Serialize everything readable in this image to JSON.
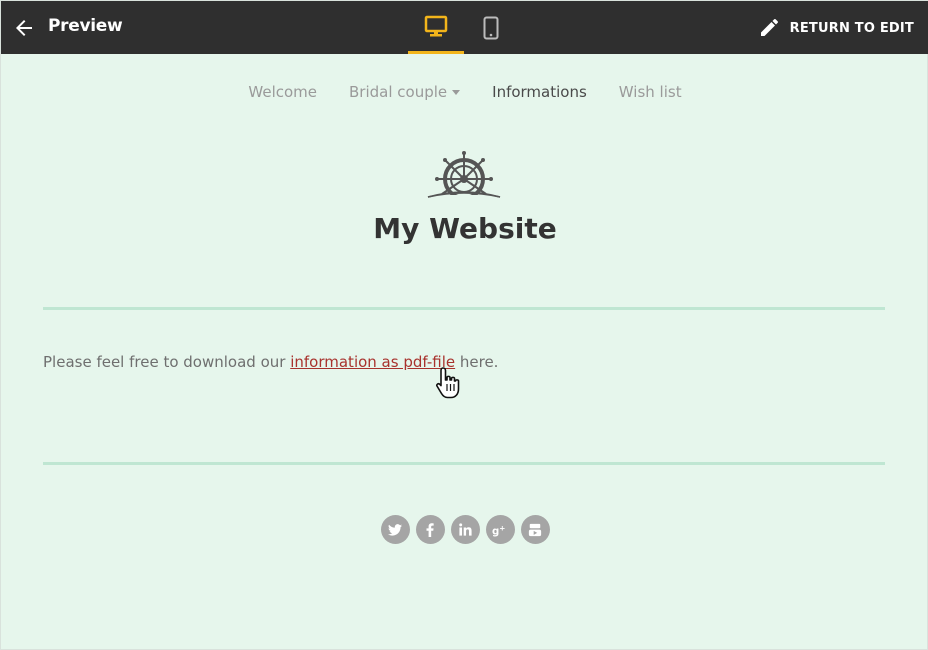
{
  "topbar": {
    "title": "Preview",
    "return_label": "RETURN TO EDIT",
    "accent_color": "#f3b51b"
  },
  "nav": {
    "items": [
      {
        "label": "Welcome"
      },
      {
        "label": "Bridal couple"
      },
      {
        "label": "Informations"
      },
      {
        "label": "Wish list"
      }
    ]
  },
  "site": {
    "title": "My Website",
    "logo_icon": "ship-wheel-icon"
  },
  "content": {
    "text_before": "Please feel free to download our ",
    "link_text": "information as pdf-file",
    "text_after": " here.",
    "link_color": "#a8322d"
  },
  "socials": {
    "items": [
      {
        "icon": "twitter-icon",
        "glyph": "t"
      },
      {
        "icon": "facebook-icon",
        "glyph": "f"
      },
      {
        "icon": "linkedin-icon",
        "glyph": "in"
      },
      {
        "icon": "google-plus-icon",
        "glyph": "g+"
      },
      {
        "icon": "youtube-icon",
        "glyph": "▶"
      }
    ]
  }
}
